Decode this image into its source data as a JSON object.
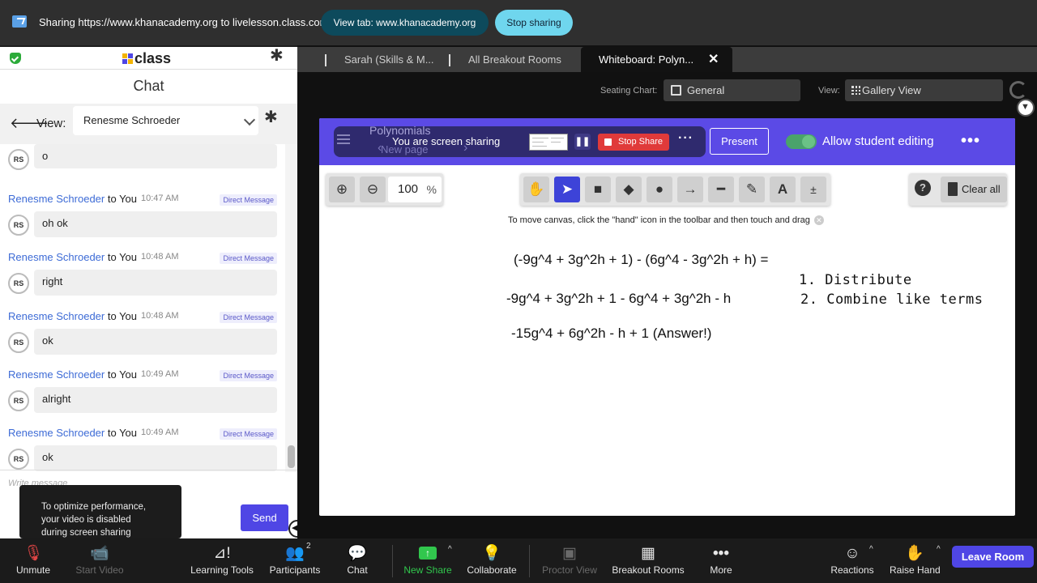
{
  "share_bar": {
    "sharing_text": "Sharing https://www.khanacademy.org to livelesson.class.com",
    "view_tab_label": "View tab: www.khanacademy.org",
    "stop_sharing_label": "Stop sharing"
  },
  "left_panel": {
    "logo_text": "class",
    "title": "Chat",
    "view_label": "View:",
    "view_selected": "Renesme Schroeder",
    "first_bubble": "o",
    "messages": [
      {
        "sender": "Renesme Schroeder",
        "recipient": "to You",
        "time": "10:47 AM",
        "tag": "Direct Message",
        "initials": "RS",
        "text": "oh ok"
      },
      {
        "sender": "Renesme Schroeder",
        "recipient": "to You",
        "time": "10:48 AM",
        "tag": "Direct Message",
        "initials": "RS",
        "text": "right"
      },
      {
        "sender": "Renesme Schroeder",
        "recipient": "to You",
        "time": "10:48 AM",
        "tag": "Direct Message",
        "initials": "RS",
        "text": "ok"
      },
      {
        "sender": "Renesme Schroeder",
        "recipient": "to You",
        "time": "10:49 AM",
        "tag": "Direct Message",
        "initials": "RS",
        "text": "alright"
      },
      {
        "sender": "Renesme Schroeder",
        "recipient": "to You",
        "time": "10:49 AM",
        "tag": "Direct Message",
        "initials": "RS",
        "text": "ok"
      }
    ],
    "first_initials": "RS",
    "input_placeholder": "Write message",
    "send_label": "Send",
    "toast_lines": [
      "To optimize performance,",
      "your video is disabled",
      "during screen sharing"
    ]
  },
  "tabs": {
    "items": [
      "Sarah (Skills & M...",
      "All Breakout Rooms",
      "Whiteboard: Polyn..."
    ],
    "close_glyph": "✕"
  },
  "seating": {
    "label": "Seating Chart:",
    "value": "General",
    "view_label": "View:",
    "view_value": "Gallery View"
  },
  "whiteboard": {
    "ghost_title": "Polynomials",
    "ghost_page": "New page",
    "screen_sharing_text": "You are screen sharing",
    "stop_share_label": "Stop Share",
    "present_label": "Present",
    "allow_editing_label": "Allow student editing",
    "zoom_value": "100",
    "zoom_unit": "%",
    "clear_all_label": "Clear all",
    "hint": "To move canvas, click the \"hand\" icon in the toolbar and then touch and drag",
    "equations": [
      "(-9g^4 + 3g^2h + 1) - (6g^4 - 3g^2h + h) =",
      "-9g^4 + 3g^2h + 1 - 6g^4 + 3g^2h - h",
      "-15g^4 + 6g^2h - h + 1 (Answer!)"
    ],
    "notes": [
      "1. Distribute",
      "2. Combine like terms"
    ]
  },
  "bottom_bar": {
    "unmute": "Unmute",
    "start_video": "Start Video",
    "learning_tools": "Learning Tools",
    "participants": "Participants",
    "participants_count": "2",
    "chat": "Chat",
    "new_share": "New Share",
    "collaborate": "Collaborate",
    "proctor_view": "Proctor View",
    "breakout_rooms": "Breakout Rooms",
    "more": "More",
    "reactions": "Reactions",
    "raise_hand": "Raise Hand",
    "leave_room": "Leave Room"
  },
  "colors": {
    "accent": "#4f46e5",
    "whiteboard_header": "#5b4ae6",
    "link_blue": "#3d6bd6",
    "share_green": "#31c74d",
    "stop_red": "#e03a3a"
  }
}
